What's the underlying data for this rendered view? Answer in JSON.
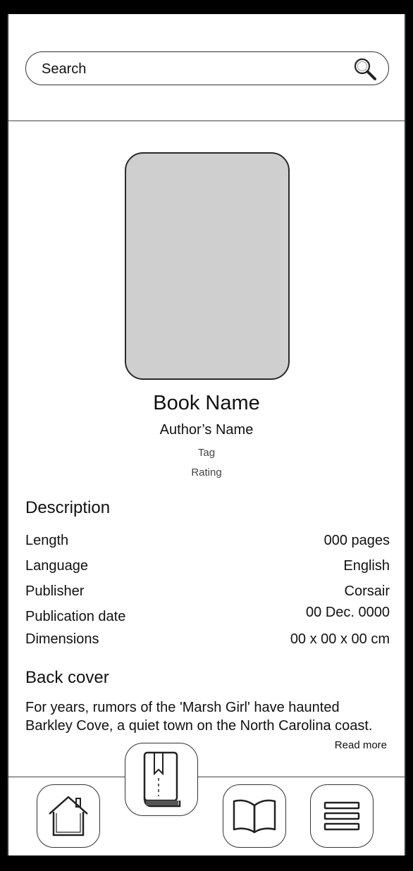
{
  "search": {
    "placeholder": "Search",
    "icon": "search-icon"
  },
  "book": {
    "name": "Book Name",
    "author": "Author’s Name",
    "tag": "Tag",
    "rating": "Rating"
  },
  "description": {
    "title": "Description",
    "rows": [
      {
        "label": "Length",
        "value": "000 pages"
      },
      {
        "label": "Language",
        "value": "English"
      },
      {
        "label": "Publisher",
        "value": "Corsair"
      },
      {
        "label": "Publication date",
        "value": "00 Dec. 0000"
      },
      {
        "label": "Dimensions",
        "value": "00 x 00 x 00 cm"
      }
    ]
  },
  "back_cover": {
    "title": "Back cover",
    "text_line1": "For years, rumors of the 'Marsh Girl' have haunted",
    "text_line2": "Barkley Cove, a quiet town on the North Carolina coast.",
    "read_more": "Read more"
  },
  "nav": {
    "items": [
      {
        "icon": "home-icon"
      },
      {
        "icon": "book-bookmark-icon",
        "active": true
      },
      {
        "icon": "open-book-icon"
      },
      {
        "icon": "menu-icon"
      }
    ]
  }
}
